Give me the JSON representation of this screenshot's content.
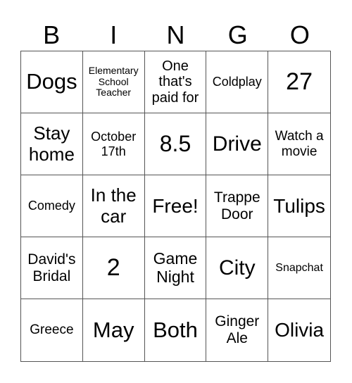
{
  "header": [
    "B",
    "I",
    "N",
    "G",
    "O"
  ],
  "cells": [
    {
      "text": "Dogs",
      "size": 31
    },
    {
      "text": "Elementary School Teacher",
      "size": 14
    },
    {
      "text": "One that's paid for",
      "size": 20
    },
    {
      "text": "Coldplay",
      "size": 18
    },
    {
      "text": "27",
      "size": 34
    },
    {
      "text": "Stay home",
      "size": 26
    },
    {
      "text": "October 17th",
      "size": 18
    },
    {
      "text": "8.5",
      "size": 32
    },
    {
      "text": "Drive",
      "size": 30
    },
    {
      "text": "Watch a movie",
      "size": 19
    },
    {
      "text": "Comedy",
      "size": 18
    },
    {
      "text": "In the car",
      "size": 26
    },
    {
      "text": "Free!",
      "size": 28
    },
    {
      "text": "Trappe Door",
      "size": 21
    },
    {
      "text": "Tulips",
      "size": 28
    },
    {
      "text": "David's Bridal",
      "size": 21
    },
    {
      "text": "2",
      "size": 34
    },
    {
      "text": "Game Night",
      "size": 23
    },
    {
      "text": "City",
      "size": 30
    },
    {
      "text": "Snapchat",
      "size": 16
    },
    {
      "text": "Greece",
      "size": 19
    },
    {
      "text": "May",
      "size": 31
    },
    {
      "text": "Both",
      "size": 31
    },
    {
      "text": "Ginger Ale",
      "size": 21
    },
    {
      "text": "Olivia",
      "size": 28
    }
  ]
}
